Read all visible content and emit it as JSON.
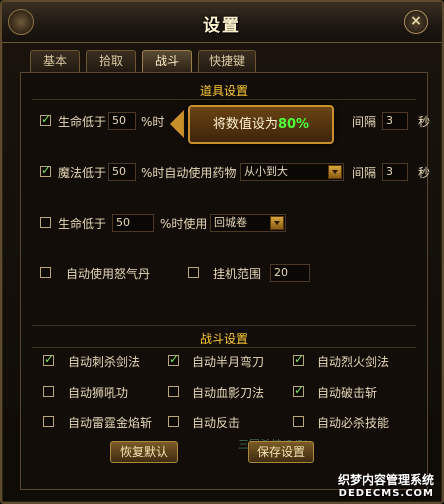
{
  "window": {
    "title": "设置",
    "close_glyph": "×"
  },
  "tabs": [
    {
      "label": "基本",
      "active": false
    },
    {
      "label": "拾取",
      "active": false
    },
    {
      "label": "战斗",
      "active": true
    },
    {
      "label": "快捷键",
      "active": false
    }
  ],
  "item_settings": {
    "title": "道具设置",
    "rows": [
      {
        "checked": true,
        "label": "生命低于",
        "value": "50",
        "suffix": "%时",
        "interval_label": "间隔",
        "interval_value": "3",
        "unit": "秒"
      },
      {
        "checked": true,
        "label": "魔法低于",
        "value": "50",
        "suffix": "%时自动使用药物",
        "select": "从小到大",
        "interval_label": "间隔",
        "interval_value": "3",
        "unit": "秒"
      },
      {
        "checked": false,
        "label": "生命低于",
        "value": "50",
        "suffix": "%时使用",
        "select": "回城卷"
      }
    ],
    "rage": {
      "checked": false,
      "label": "自动使用怒气丹"
    },
    "idle": {
      "checked": false,
      "label": "挂机范围",
      "value": "20"
    }
  },
  "tooltip": {
    "prefix": "将数值设为",
    "percent": "80%"
  },
  "combat_settings": {
    "title": "战斗设置",
    "skills": [
      {
        "label": "自动刺杀剑法",
        "checked": true
      },
      {
        "label": "自动半月弯刀",
        "checked": true
      },
      {
        "label": "自动烈火剑法",
        "checked": true
      },
      {
        "label": "自动狮吼功",
        "checked": false
      },
      {
        "label": "自动血影刀法",
        "checked": false
      },
      {
        "label": "自动破击斩",
        "checked": true
      },
      {
        "label": "自动雷霆金焰斩",
        "checked": false
      },
      {
        "label": "自动反击",
        "checked": false
      },
      {
        "label": "自动必杀技能",
        "checked": false
      }
    ]
  },
  "buttons": {
    "restore": "恢复默认",
    "save": "保存设置"
  },
  "watermark": "三国杀神(2/2)",
  "brand": {
    "line1": "织梦内容管理系统",
    "line2": "DEDECMS.COM"
  }
}
